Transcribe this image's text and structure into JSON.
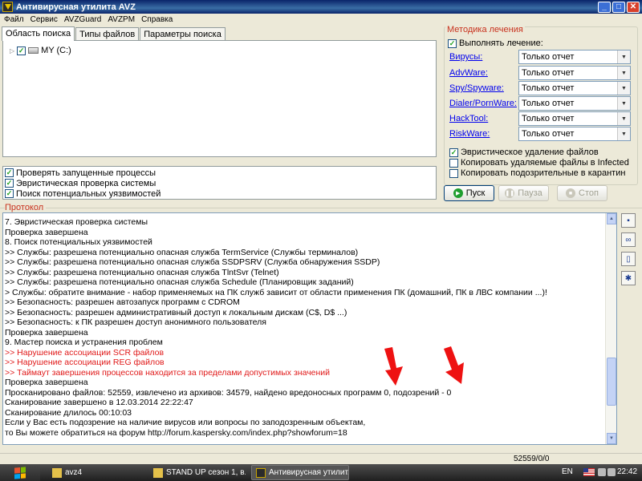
{
  "window": {
    "title": "Антивирусная утилита AVZ",
    "buttons": {
      "minimize": "_",
      "maximize": "□",
      "close": "✕"
    }
  },
  "menu": [
    "Файл",
    "Сервис",
    "AVZGuard",
    "AVZPM",
    "Справка"
  ],
  "tabs": [
    "Область поиска",
    "Типы файлов",
    "Параметры поиска"
  ],
  "tree": {
    "drive_label": "MY (C:)"
  },
  "left_checks": [
    "Проверять запущенные процессы",
    "Эвристическая проверка системы",
    "Поиск потенциальных уязвимостей"
  ],
  "treatment": {
    "legend": "Методика лечения",
    "perform_label": "Выполнять лечение:",
    "rules": [
      {
        "label": "Вирусы:",
        "value": "Только отчет"
      },
      {
        "label": "AdvWare:",
        "value": "Только отчет"
      },
      {
        "label": "Spy/Spyware:",
        "value": "Только отчет"
      },
      {
        "label": "Dialer/PornWare:",
        "value": "Только отчет"
      },
      {
        "label": "HackTool:",
        "value": "Только отчет"
      },
      {
        "label": "RiskWare:",
        "value": "Только отчет"
      }
    ],
    "options": [
      {
        "label": "Эвристическое удаление файлов",
        "checked": true
      },
      {
        "label": "Копировать удаляемые файлы в  Infected",
        "checked": false
      },
      {
        "label": "Копировать подозрительные в  карантин",
        "checked": false
      }
    ]
  },
  "actions": {
    "start": "Пуск",
    "pause": "Пауза",
    "stop": "Стоп"
  },
  "protocol": {
    "label": "Протокол",
    "lines": [
      {
        "text": "7. Эвристическая проверка системы",
        "red": false
      },
      {
        "text": "Проверка завершена",
        "red": false
      },
      {
        "text": "8. Поиск потенциальных уязвимостей",
        "red": false
      },
      {
        "text": ">> Службы: разрешена потенциально опасная служба TermService (Службы терминалов)",
        "red": false
      },
      {
        "text": ">> Службы: разрешена потенциально опасная служба SSDPSRV (Служба обнаружения SSDP)",
        "red": false
      },
      {
        "text": ">> Службы: разрешена потенциально опасная служба TlntSvr (Telnet)",
        "red": false
      },
      {
        "text": ">> Службы: разрешена потенциально опасная служба Schedule (Планировщик заданий)",
        "red": false
      },
      {
        "text": "> Службы: обратите внимание - набор применяемых на ПК служб зависит от области применения ПК (домашний, ПК в ЛВС компании ...)!",
        "red": false
      },
      {
        "text": ">> Безопасность: разрешен автозапуск программ с CDROM",
        "red": false
      },
      {
        "text": ">> Безопасность: разрешен административный доступ к локальным дискам (C$, D$ ...)",
        "red": false
      },
      {
        "text": ">> Безопасность: к ПК разрешен доступ анонимного пользователя",
        "red": false
      },
      {
        "text": "Проверка завершена",
        "red": false
      },
      {
        "text": "9. Мастер поиска и устранения проблем",
        "red": false
      },
      {
        "text": " >> Нарушение ассоциации SCR файлов",
        "red": true
      },
      {
        "text": " >> Нарушение ассоциации REG файлов",
        "red": true
      },
      {
        "text": " >> Таймаут завершения процессов находится за пределами допустимых значений",
        "red": true
      },
      {
        "text": "Проверка завершена",
        "red": false
      },
      {
        "text": "Просканировано файлов: 52559, извлечено из архивов: 34579, найдено вредоносных программ 0, подозрений - 0",
        "red": false
      },
      {
        "text": "Сканирование завершено в 12.03.2014 22:22:47",
        "red": false
      },
      {
        "text": "Сканирование длилось 00:10:03",
        "red": false
      },
      {
        "text": "Если у Вас есть подозрение на наличие вирусов или вопросы по заподозренным объектам,",
        "red": false
      },
      {
        "text": "то Вы можете обратиться на форум http://forum.kaspersky.com/index.php?showforum=18",
        "red": false
      }
    ]
  },
  "status": {
    "counts": "52559/0/0"
  },
  "taskbar": {
    "tasks": [
      "avz4",
      "STAND UP сезон 1, в...",
      "Антивирусная утилит..."
    ],
    "lang": "EN",
    "clock": "22:42"
  },
  "colors": {
    "accent_red": "#c8321e",
    "link_blue": "#0000ee",
    "log_red": "#e01818"
  }
}
